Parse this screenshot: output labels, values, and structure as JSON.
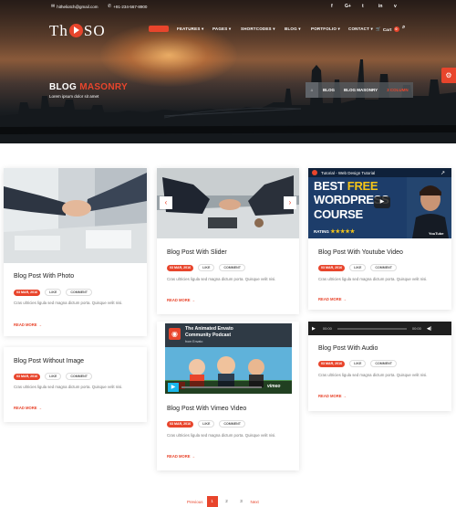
{
  "topbar": {
    "email": "hitheliotch@gmail.com",
    "phone": "+91-234-567-8900",
    "social_icons": [
      "facebook-icon",
      "google-plus-icon",
      "twitter-icon",
      "linkedin-icon",
      "vimeo-icon"
    ],
    "social_glyphs": [
      "f",
      "G+",
      "t",
      "in",
      "v"
    ]
  },
  "logo": {
    "left": "Th",
    "right": "SO"
  },
  "nav": {
    "items": [
      "HOME",
      "FEATURES ▾",
      "PAGES ▾",
      "SHORTCODES ▾",
      "BLOG ▾",
      "PORTFOLIO ▾",
      "CONTACT ▾"
    ],
    "cart_label": "Cart",
    "cart_count": "0"
  },
  "header": {
    "title_main": "BLOG",
    "title_accent": "MASONRY",
    "subtitle": "Lorem ipsum dolor sit amet"
  },
  "breadcrumb": {
    "home_icon": "home-icon",
    "items": [
      "BLOG",
      "BLOG MASONRY"
    ],
    "current": "3 COLUMN"
  },
  "colors": {
    "accent": "#e8452c"
  },
  "posts": [
    {
      "title": "Blog Post With Photo",
      "date": "03 MAR, 2016",
      "like": "LIKE",
      "comment": "COMMENT",
      "excerpt": "Cras ultricies ligula sed magna dictum porta. Quisque velit nisi.",
      "read_more": "READ MORE →"
    },
    {
      "title": "Blog Post Without Image",
      "date": "03 MAR, 2016",
      "like": "LIKE",
      "comment": "COMMENT",
      "excerpt": "Cras ultricies ligula sed magna dictum porta. Quisque velit nisi.",
      "read_more": "READ MORE →"
    },
    {
      "title": "Blog Post With Slider",
      "date": "03 MAR, 2016",
      "like": "LIKE",
      "comment": "COMMENT",
      "excerpt": "Cras ultricies ligula sed magna dictum porta. Quisque velit nisi.",
      "read_more": "READ MORE →"
    },
    {
      "title": "Blog Post With Vimeo Video",
      "date": "03 MAR, 2016",
      "like": "LIKE",
      "comment": "COMMENT",
      "excerpt": "Cras ultricies ligula sed magna dictum porta. Quisque velit nisi.",
      "read_more": "READ MORE →"
    },
    {
      "title": "Blog Post With Youtube Video",
      "date": "03 MAR, 2016",
      "like": "LIKE",
      "comment": "COMMENT",
      "excerpt": "Cras ultricies ligula sed magna dictum porta. Quisque velit nisi.",
      "read_more": "READ MORE →"
    },
    {
      "title": "Blog Post With Audio",
      "date": "03 MAR, 2016",
      "like": "LIKE",
      "comment": "COMMENT",
      "excerpt": "Cras ultricies ligula sed magna dictum porta. Quisque velit nisi.",
      "read_more": "READ MORE →"
    }
  ],
  "youtube": {
    "video_title": "Tutorial - Web Design Tutorial",
    "line1": "BEST",
    "line1_accent": "FREE",
    "line2": "WORDPRESS",
    "line3": "COURSE",
    "rating_label": "RATING",
    "stars": "★★★★★",
    "platform": "YouTube"
  },
  "vimeo": {
    "line1": "The Animated Envato",
    "line2": "Community Podcast",
    "byline": "from Envato",
    "brand": "vimeo"
  },
  "audio": {
    "current_time": "00:00",
    "duration": "00:00"
  },
  "pagination": {
    "prev": "Previous",
    "pages": [
      "1",
      "2",
      "3"
    ],
    "current_index": 0,
    "next": "Next"
  }
}
